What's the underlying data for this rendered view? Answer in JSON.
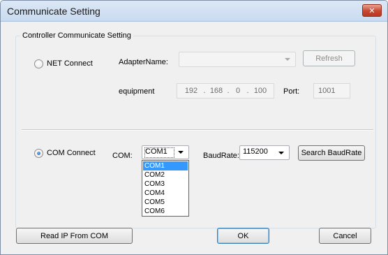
{
  "window": {
    "title": "Communicate Setting",
    "close_glyph": "✕"
  },
  "group": {
    "legend": "Controller Communicate Setting"
  },
  "net": {
    "radio_label": "NET Connect",
    "selected": false,
    "adapter_label": "AdapterName:",
    "adapter_value": "",
    "refresh_label": "Refresh",
    "equipment_label": "equipment",
    "ip": [
      "192",
      "168",
      "0",
      "100"
    ],
    "port_label": "Port:",
    "port_value": "1001"
  },
  "com": {
    "radio_label": "COM Connect",
    "selected": true,
    "com_label": "COM:",
    "com_value": "COM1",
    "com_options": [
      "COM1",
      "COM2",
      "COM3",
      "COM4",
      "COM5",
      "COM6"
    ],
    "baud_label": "BaudRate:",
    "baud_value": "115200",
    "search_baud_label": "Search BaudRate"
  },
  "footer": {
    "read_ip_label": "Read IP From COM",
    "ok_label": "OK",
    "cancel_label": "Cancel"
  },
  "icons": {
    "close": "close-icon",
    "dropdown": "chevron-down-icon"
  },
  "colors": {
    "selection": "#3399ff",
    "title_bar": "#c9dbf0",
    "close_button": "#c7462e"
  }
}
